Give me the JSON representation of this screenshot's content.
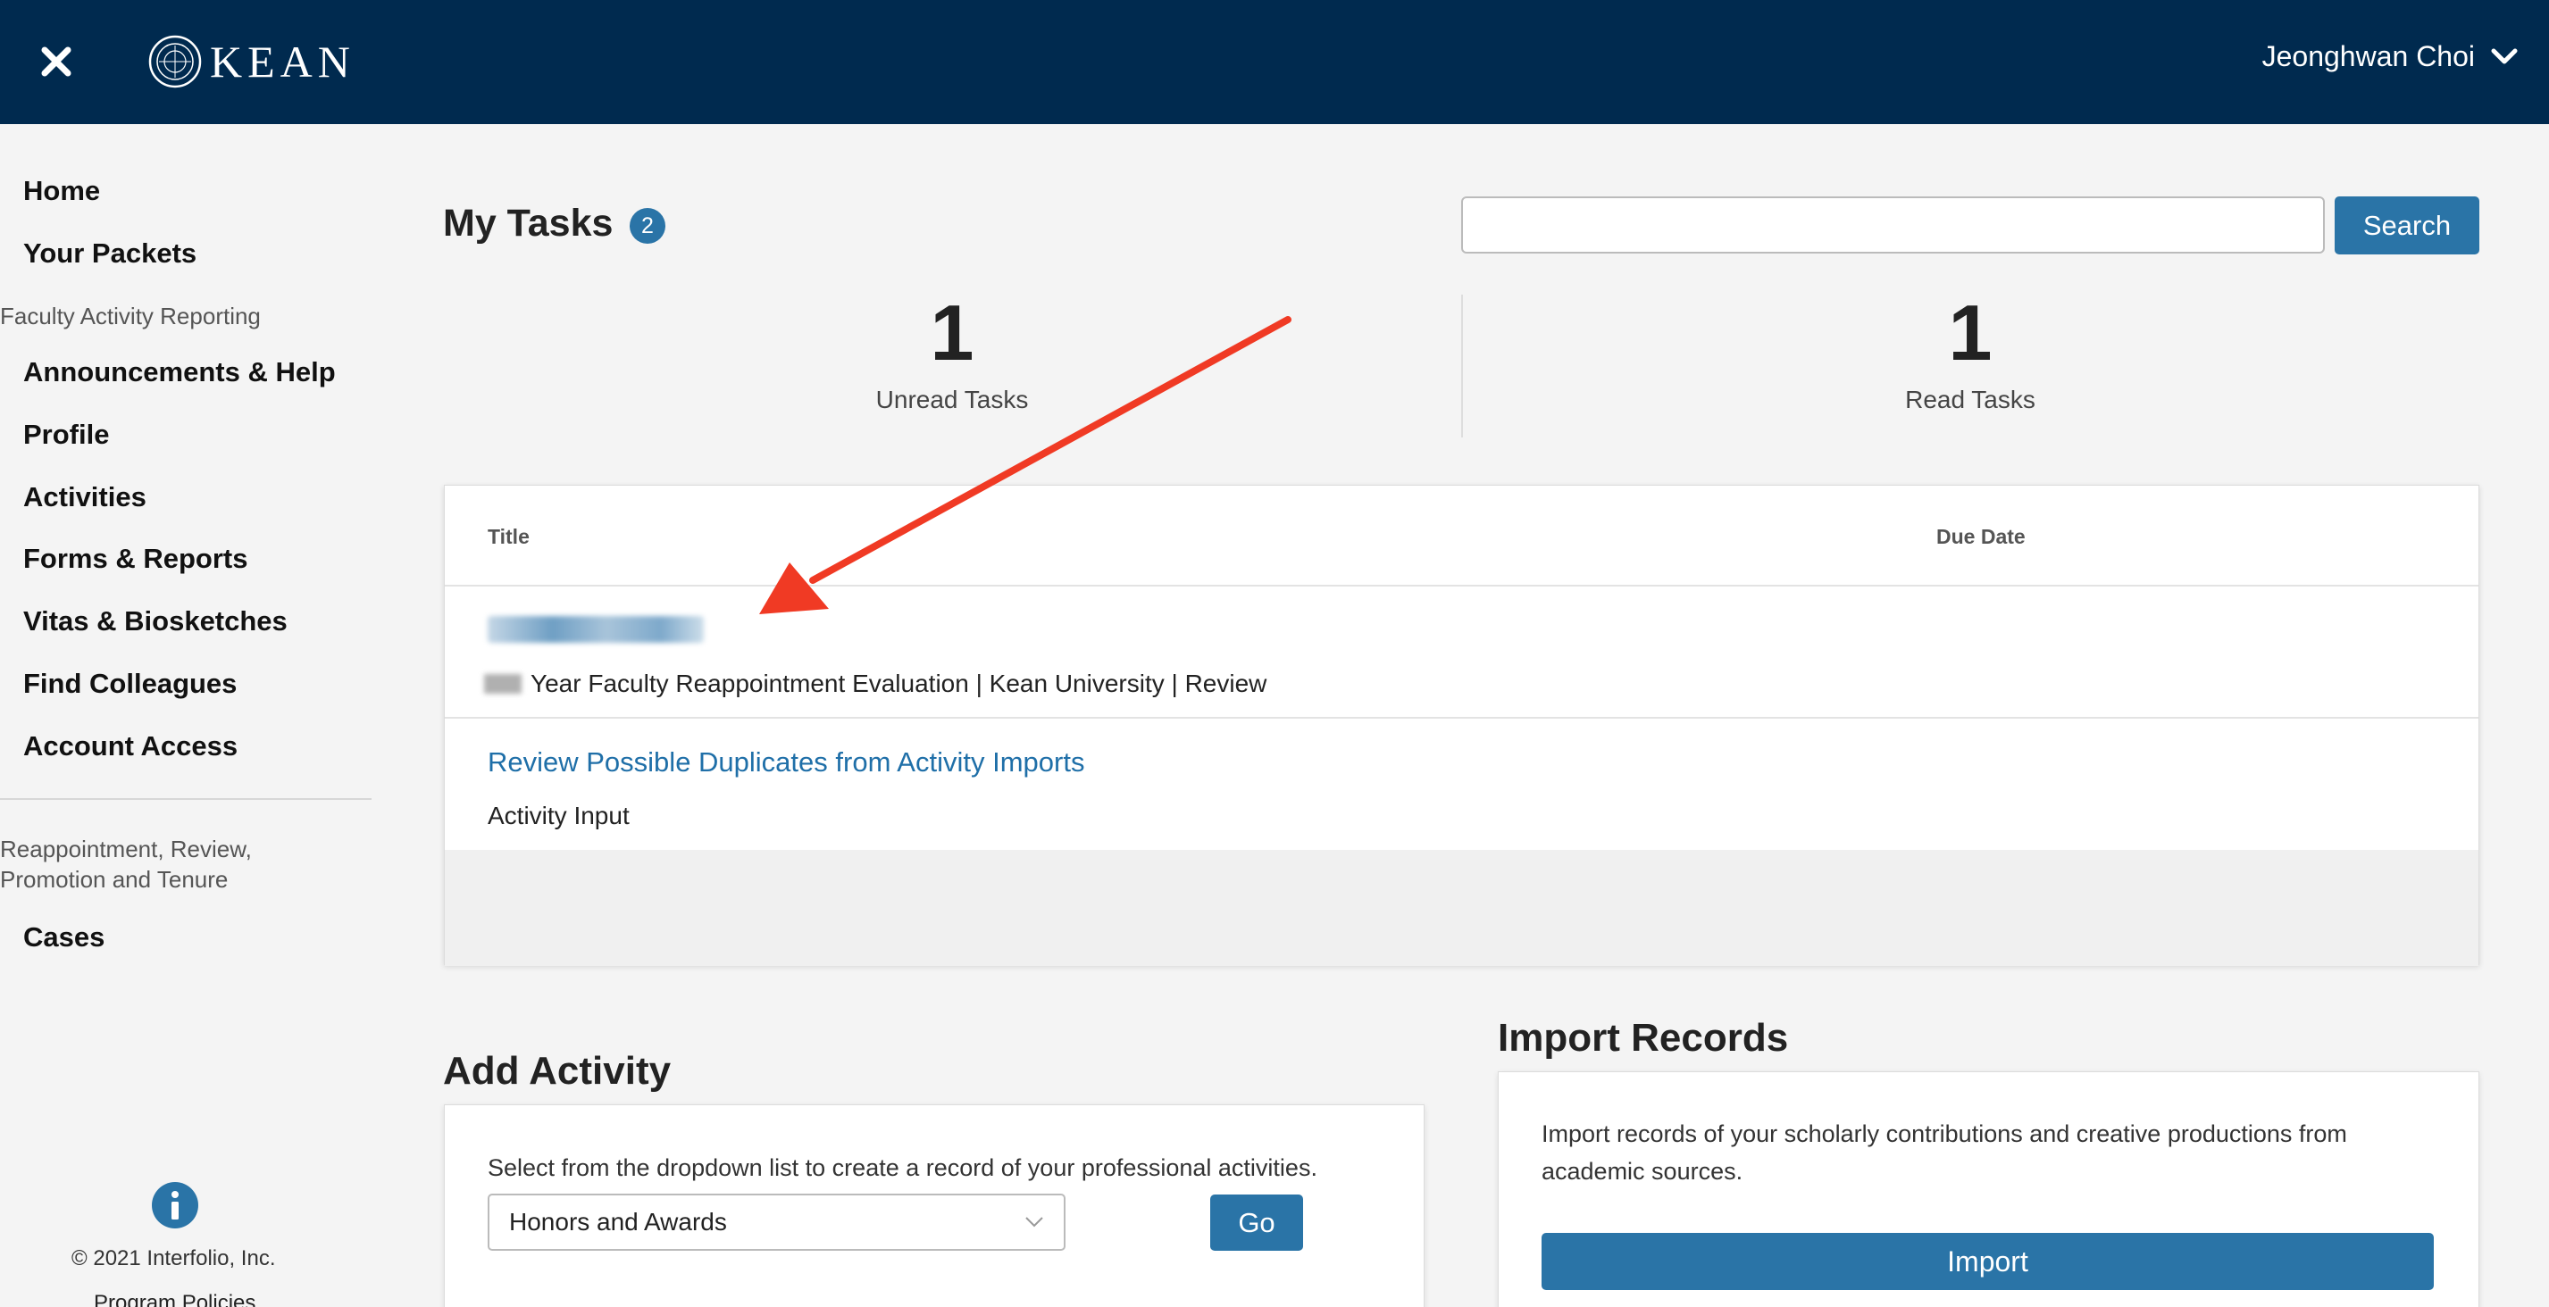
{
  "header": {
    "logo_text": "KEAN",
    "user_name": "Jeonghwan Choi"
  },
  "sidebar": {
    "items": [
      {
        "label": "Home"
      },
      {
        "label": "Your Packets"
      },
      {
        "label": "Announcements & Help"
      },
      {
        "label": "Profile"
      },
      {
        "label": "Activities"
      },
      {
        "label": "Forms & Reports"
      },
      {
        "label": "Vitas & Biosketches"
      },
      {
        "label": "Find Colleagues"
      },
      {
        "label": "Account Access"
      },
      {
        "label": "Cases"
      }
    ],
    "section_far": "Faculty Activity Reporting",
    "section_rpt_line1": "Reappointment, Review,",
    "section_rpt_line2": "Promotion and Tenure",
    "copyright": "© 2021 Interfolio, Inc.",
    "program_policies": "Program Policies"
  },
  "main": {
    "title": "My Tasks",
    "task_count": "2",
    "search_button": "Search",
    "search_value": "",
    "unread_count": "1",
    "unread_label": "Unread Tasks",
    "read_count": "1",
    "read_label": "Read Tasks",
    "table": {
      "col_title": "Title",
      "col_due": "Due Date",
      "rows": [
        {
          "subtitle": "Year Faculty Reappointment Evaluation | Kean University | Review"
        },
        {
          "title": "Review Possible Duplicates from Activity Imports",
          "subtitle": "Activity Input"
        }
      ]
    }
  },
  "add_activity": {
    "title": "Add Activity",
    "description": "Select from the dropdown list to create a record of your professional activities.",
    "selected_option": "Honors and Awards",
    "go_button": "Go"
  },
  "import_records": {
    "title": "Import Records",
    "description_line1": "Import records of your scholarly contributions and creative productions from",
    "description_line2": "academic sources.",
    "import_button": "Import"
  },
  "colors": {
    "header_bg": "#002a4f",
    "accent": "#2a74a7",
    "link": "#1f6fa8",
    "annotation_arrow": "#f03a24"
  }
}
